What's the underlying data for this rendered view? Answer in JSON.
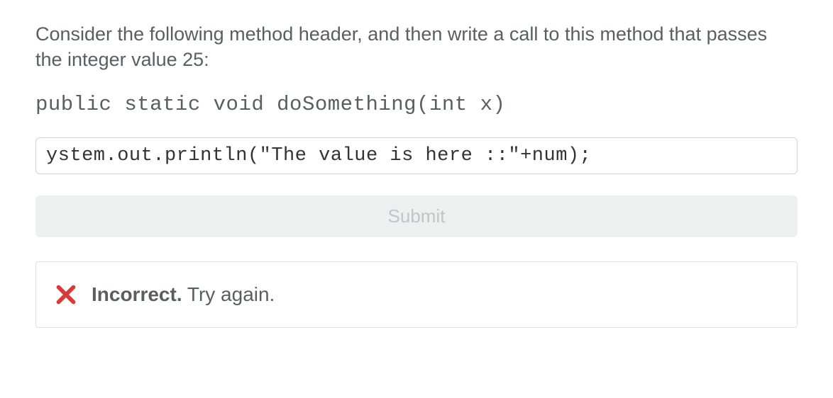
{
  "question": {
    "prompt_text": "Consider the following method header, and then write a call to this method that passes the integer value 25:",
    "code_header": "public static void doSomething(int x)"
  },
  "answer": {
    "input_value": "ystem.out.println(\"The value is here ::\"+num);"
  },
  "controls": {
    "submit_label": "Submit"
  },
  "feedback": {
    "icon": "x-icon",
    "status_bold": "Incorrect.",
    "status_rest": " Try again.",
    "color": "#d83a3a"
  }
}
